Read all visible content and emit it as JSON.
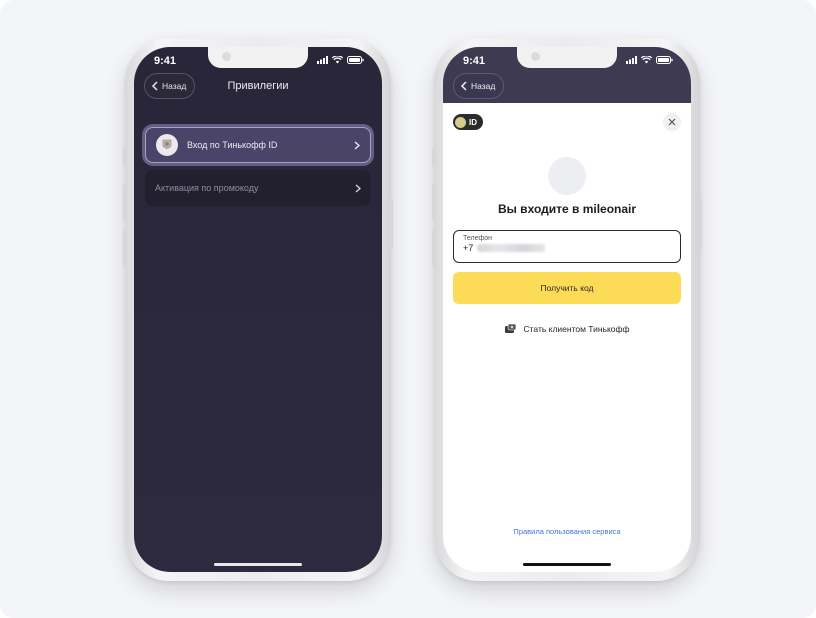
{
  "status": {
    "time": "9:41"
  },
  "left_screen": {
    "back_label": "Назад",
    "title": "Привилегии",
    "items": [
      {
        "label": "Вход по Тинькофф ID",
        "state": "active"
      },
      {
        "label": "Активация по промокоду",
        "state": "inactive"
      }
    ]
  },
  "right_screen": {
    "back_label": "Назад",
    "badge_label": "ID",
    "heading": "Вы входите в mileonair",
    "phone_field": {
      "label": "Телефон",
      "prefix": "+7"
    },
    "submit_label": "Получить код",
    "become_client_label": "Стать клиентом Тинькофф",
    "terms_link": "Правила пользования сервиса"
  },
  "colors": {
    "dark_bg": "#2d2a40",
    "accent_yellow": "#fcdc56",
    "link_blue": "#3d78d8",
    "active_item": "#4a4468"
  },
  "icons": [
    "chevron-left-icon",
    "chevron-right-icon",
    "signal-icon",
    "wifi-icon",
    "battery-icon",
    "close-icon",
    "tinkoff-emblem-icon"
  ]
}
